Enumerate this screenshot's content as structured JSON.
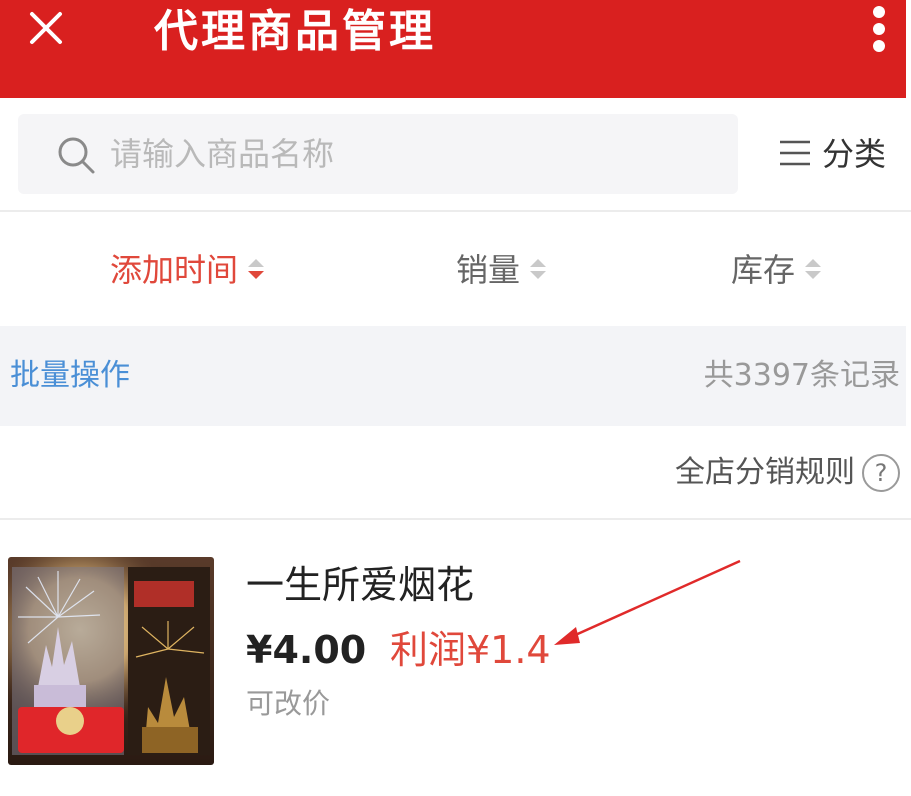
{
  "header": {
    "title": "代理商品管理"
  },
  "search": {
    "placeholder": "请输入商品名称"
  },
  "category": {
    "label": "分类"
  },
  "sort_tabs": [
    {
      "label": "添加时间",
      "active": true
    },
    {
      "label": "销量",
      "active": false
    },
    {
      "label": "库存",
      "active": false
    }
  ],
  "batch": {
    "label": "批量操作",
    "record_count": "共3397条记录"
  },
  "rules": {
    "label": "全店分销规则",
    "help_symbol": "?"
  },
  "product": {
    "name": "一生所爱烟花",
    "price": "¥4.00",
    "profit": "利润¥1.4",
    "editable_note": "可改价"
  },
  "colors": {
    "header_bg": "#d9201f",
    "accent": "#e0483b",
    "link": "#4a8fd6"
  },
  "icons": [
    "close-icon",
    "more-vertical-icon",
    "search-icon",
    "menu-lines-icon",
    "sort-arrows-icon",
    "help-circle-icon"
  ]
}
